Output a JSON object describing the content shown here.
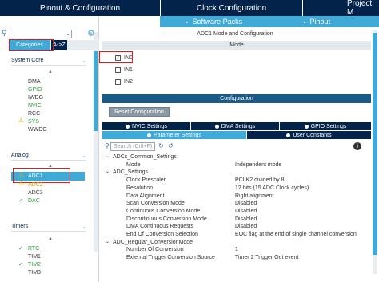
{
  "top_tabs": {
    "pinout": "Pinout & Configuration",
    "clock": "Clock Configuration",
    "project": "Project M"
  },
  "subbar": {
    "software_packs": "Software Packs",
    "pinout": "Pinout"
  },
  "left": {
    "search_value": "",
    "tab_categories": "Categories",
    "tab_az": "A->Z",
    "groups": {
      "system_core": {
        "label": "System Core",
        "items": [
          "DMA",
          "GPIO",
          "IWDG",
          "NVIC",
          "RCC",
          "SYS",
          "WWDG"
        ]
      },
      "analog": {
        "label": "Analog",
        "items": [
          "ADC1",
          "ADC2",
          "ADC3",
          "DAC"
        ]
      },
      "timers": {
        "label": "Timers",
        "items": [
          "RTC",
          "TIM1",
          "TIM2",
          "TIM3"
        ]
      }
    }
  },
  "right": {
    "mode_title": "ADC1 Mode and Configuration",
    "mode_header": "Mode",
    "mode_inputs": [
      {
        "label": "IN0",
        "checked": true
      },
      {
        "label": "IN1",
        "checked": false
      },
      {
        "label": "IN2",
        "checked": false
      }
    ],
    "config_header": "Configuration",
    "reset_button": "Reset Configuration",
    "subtabs": {
      "nvic": "NVIC Settings",
      "dma": "DMA Settings",
      "gpio": "GPIO Settings",
      "param": "Parameter Settings",
      "user": "User Constants"
    },
    "search_placeholder": "Search (Crtl+F)",
    "params": [
      {
        "group": "ADCs_Common_Settings"
      },
      {
        "name": "Mode",
        "value": "Independent mode"
      },
      {
        "group": "ADC_Settings"
      },
      {
        "name": "Clock Prescaler",
        "value": "PCLK2 divided by 8"
      },
      {
        "name": "Resolution",
        "value": "12 bits (15 ADC Clock cycles)"
      },
      {
        "name": "Data Alignment",
        "value": "Right alignment"
      },
      {
        "name": "Scan Conversion Mode",
        "value": "Disabled"
      },
      {
        "name": "Continuous Conversion Mode",
        "value": "Disabled"
      },
      {
        "name": "Discontinuous Conversion Mode",
        "value": "Disabled"
      },
      {
        "name": "DMA Continuous Requests",
        "value": "Disabled"
      },
      {
        "name": "End Of Conversion Selection",
        "value": "EOC flag at the end of single channel conversion"
      },
      {
        "group": "ADC_Regular_ConversionMode"
      },
      {
        "name": "Number Of Conversion",
        "value": "1"
      },
      {
        "name": "External Trigger Conversion Source",
        "value": "Timer 2 Trigger Out event"
      }
    ]
  },
  "colors": {
    "navy": "#03234b",
    "accent": "#3fa9d8",
    "highlight_red": "#e01b1b",
    "ok_green": "#2e9b3b",
    "warn_yellow": "#e8b400"
  }
}
